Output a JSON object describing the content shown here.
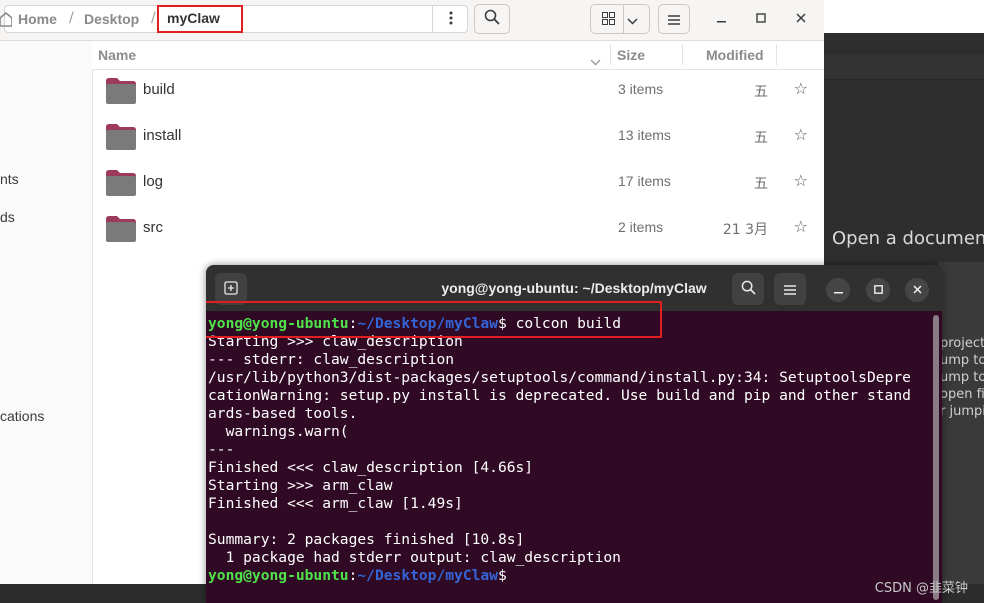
{
  "file_manager": {
    "breadcrumb": {
      "home": "Home",
      "desktop": "Desktop",
      "current": "myClaw",
      "separator": "/"
    },
    "sidebar": [
      "nts",
      "ds",
      "cations"
    ],
    "columns": {
      "name": "Name",
      "size": "Size",
      "modified": "Modified"
    },
    "rows": [
      {
        "name": "build",
        "size": "3 items",
        "modified": "五"
      },
      {
        "name": "install",
        "size": "13 items",
        "modified": "五"
      },
      {
        "name": "log",
        "size": "17 items",
        "modified": "五"
      },
      {
        "name": "src",
        "size": "2 items",
        "modified": "21 3月"
      }
    ]
  },
  "terminal": {
    "title": "yong@yong-ubuntu: ~/Desktop/myClaw",
    "prompt_user": "yong@yong-ubuntu",
    "prompt_path": "~/Desktop/myClaw",
    "command": "colcon build",
    "output": [
      "Starting >>> claw_description",
      "--- stderr: claw_description",
      "/usr/lib/python3/dist-packages/setuptools/command/install.py:34: SetuptoolsDepre",
      "cationWarning: setup.py install is deprecated. Use build and pip and other stand",
      "ards-based tools.",
      "  warnings.warn(",
      "---",
      "Finished <<< claw_description [4.66s]",
      "Starting >>> arm_claw",
      "Finished <<< arm_claw [1.49s]",
      "",
      "Summary: 2 packages finished [10.8s]",
      "  1 package had stderr output: claw_description"
    ]
  },
  "background_editor": {
    "open_document": "Open a documen",
    "panel_lines": [
      "project",
      "ump to",
      "ump to",
      "open fi",
      "r jumpi"
    ]
  },
  "watermark": "CSDN @韭菜钟",
  "colors": {
    "terminal_bg": "#300a24",
    "prompt_user": "#4fe24a",
    "prompt_path": "#3465d8",
    "highlight": "#e02020",
    "folder": "#7a7a7a"
  }
}
